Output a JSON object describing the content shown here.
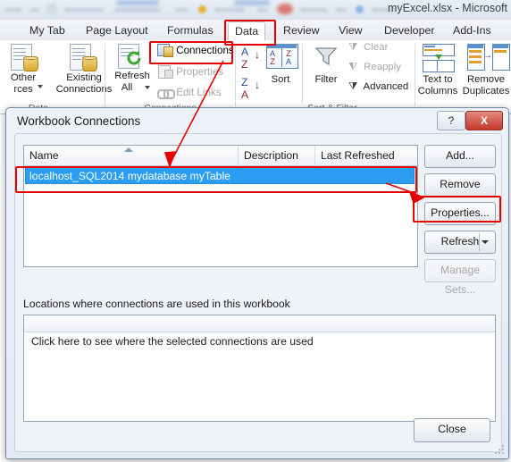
{
  "window": {
    "title": "myExcel.xlsx  -  Microsoft"
  },
  "ribbon": {
    "tabs": [
      {
        "label": "My Tab",
        "active": false
      },
      {
        "label": "Page Layout",
        "active": false
      },
      {
        "label": "Formulas",
        "active": false
      },
      {
        "label": "Data",
        "active": true
      },
      {
        "label": "Review",
        "active": false
      },
      {
        "label": "View",
        "active": false
      },
      {
        "label": "Developer",
        "active": false
      },
      {
        "label": "Add-Ins",
        "active": false
      }
    ],
    "groups": [
      {
        "label": "Data"
      },
      {
        "label": "Connections"
      },
      {
        "label": "Sort & Filter"
      },
      {
        "label": ""
      }
    ],
    "commands": {
      "other_sources": "Other\nrces",
      "other_sources_l1": "Other",
      "other_sources_l2": "rces",
      "existing_connections_l1": "Existing",
      "existing_connections_l2": "Connections",
      "refresh_all_l1": "Refresh",
      "refresh_all_l2": "All",
      "connections": "Connections",
      "properties": "Properties",
      "edit_links": "Edit Links",
      "sort": "Sort",
      "filter": "Filter",
      "clear": "Clear",
      "reapply": "Reapply",
      "advanced": "Advanced",
      "text_to_columns_l1": "Text to",
      "text_to_columns_l2": "Columns",
      "remove_duplicates_l1": "Remove",
      "remove_duplicates_l2": "Duplicates"
    }
  },
  "dialog": {
    "title": "Workbook Connections",
    "help_button": "?",
    "close_button": "X",
    "columns": [
      "Name",
      "Description",
      "Last Refreshed"
    ],
    "rows": [
      {
        "name": "localhost_SQL2014 mydatabase myTable",
        "description": "",
        "last_refreshed": "",
        "selected": true
      }
    ],
    "buttons": {
      "add": "Add...",
      "remove": "Remove",
      "properties": "Properties...",
      "refresh": "Refresh",
      "manage_sets": "Manage Sets...",
      "close": "Close"
    },
    "locations_label": "Locations where connections are used in this workbook",
    "locations_text": "Click here to see where the selected connections are used"
  },
  "annotations": {
    "highlight_color": "#e60000",
    "highlights": [
      "data-tab",
      "connections-button",
      "connection-row",
      "properties-button"
    ]
  }
}
